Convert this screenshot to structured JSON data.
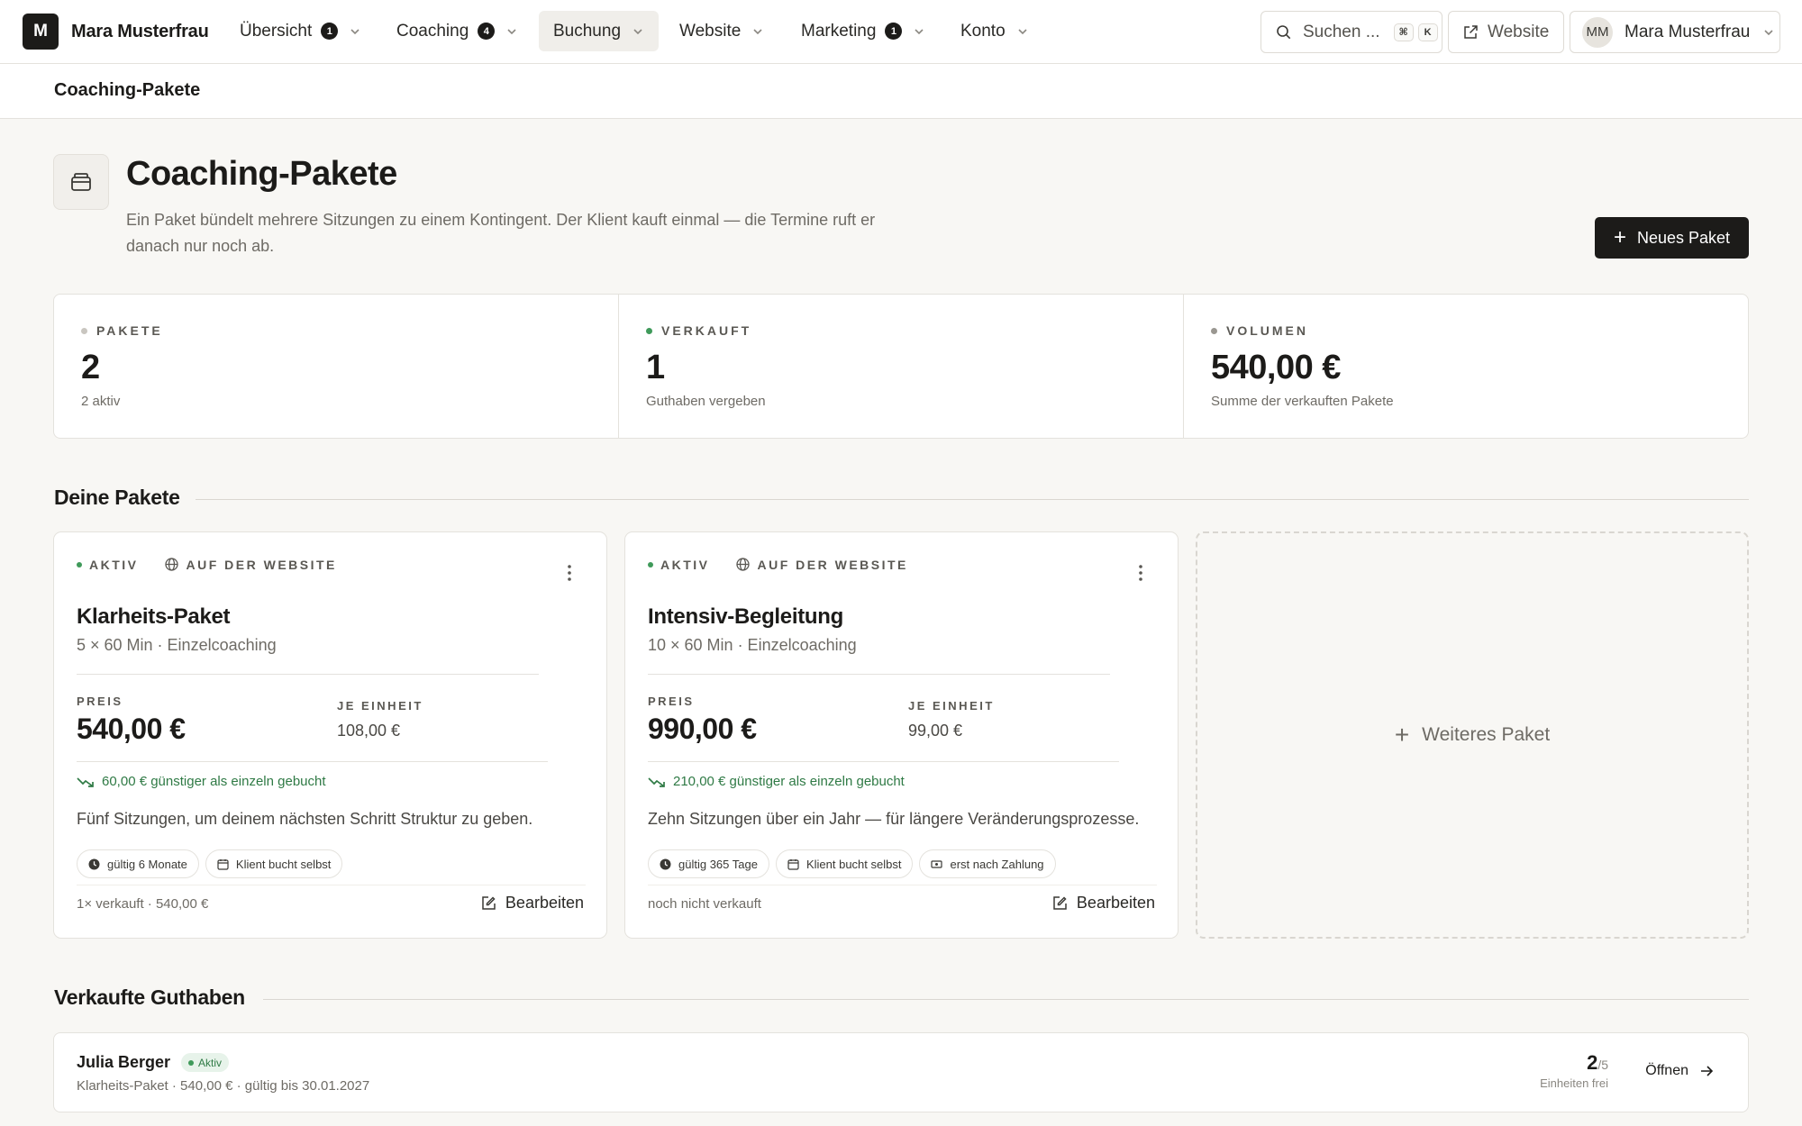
{
  "brand": {
    "initial": "M",
    "name": "Mara Musterfrau"
  },
  "nav": [
    {
      "label": "Übersicht",
      "badge": "1"
    },
    {
      "label": "Coaching",
      "badge": "4"
    },
    {
      "label": "Buchung",
      "badge": ""
    },
    {
      "label": "Website",
      "badge": ""
    },
    {
      "label": "Marketing",
      "badge": "1"
    },
    {
      "label": "Konto",
      "badge": ""
    }
  ],
  "search": {
    "label": "Suchen ...",
    "key1": "⌘",
    "key2": "K"
  },
  "website_button": "Website",
  "user": {
    "initials": "MM",
    "name": "Mara Musterfrau"
  },
  "breadcrumb": "Coaching-Pakete",
  "header": {
    "title": "Coaching-Pakete",
    "description": "Ein Paket bündelt mehrere Sitzungen zu einem Kontingent. Der Klient kauft einmal — die Termine ruft er danach nur noch ab.",
    "new_button": "Neues Paket"
  },
  "stats": [
    {
      "label": "PAKETE",
      "value": "2",
      "sub": "2 aktiv",
      "dot": "#c9c6c0"
    },
    {
      "label": "VERKAUFT",
      "value": "1",
      "sub": "Guthaben vergeben",
      "dot": "#3f9a5a"
    },
    {
      "label": "VOLUMEN",
      "value": "540,00 €",
      "sub": "Summe der verkauften Pakete",
      "dot": "#9a9791"
    }
  ],
  "sections": {
    "packages": "Deine Pakete",
    "credits": "Verkaufte Guthaben"
  },
  "packages": [
    {
      "status": "AKTIV",
      "visibility": "AUF DER WEBSITE",
      "title": "Klarheits-Paket",
      "subtitle": "5 × 60 Min · Einzelcoaching",
      "price_label": "PREIS",
      "price": "540,00 €",
      "unit_label": "JE EINHEIT",
      "unit_price": "108,00 €",
      "saving": "60,00 € günstiger als einzeln gebucht",
      "description": "Fünf Sitzungen, um deinem nächsten Schritt Struktur zu geben.",
      "chips": [
        {
          "icon": "clock-icon",
          "label": "gültig 6 Monate"
        },
        {
          "icon": "calendar-icon",
          "label": "Klient bucht selbst"
        }
      ],
      "footer": "1× verkauft · 540,00 €",
      "edit": "Bearbeiten"
    },
    {
      "status": "AKTIV",
      "visibility": "AUF DER WEBSITE",
      "title": "Intensiv-Begleitung",
      "subtitle": "10 × 60 Min · Einzelcoaching",
      "price_label": "PREIS",
      "price": "990,00 €",
      "unit_label": "JE EINHEIT",
      "unit_price": "99,00 €",
      "saving": "210,00 € günstiger als einzeln gebucht",
      "description": "Zehn Sitzungen über ein Jahr — für längere Veränderungsprozesse.",
      "chips": [
        {
          "icon": "clock-icon",
          "label": "gültig 365 Tage"
        },
        {
          "icon": "calendar-icon",
          "label": "Klient bucht selbst"
        },
        {
          "icon": "payment-icon",
          "label": "erst nach Zahlung"
        }
      ],
      "footer": "noch nicht verkauft",
      "edit": "Bearbeiten"
    }
  ],
  "add_package": "Weiteres Paket",
  "credits": [
    {
      "name": "Julia Berger",
      "status": "Aktiv",
      "meta": "Klarheits-Paket · 540,00 € · gültig bis 30.01.2027",
      "remaining": "2",
      "total": "/5",
      "remaining_label": "Einheiten frei",
      "action": "Öffnen"
    }
  ],
  "colors": {
    "accent": "#1c1b19",
    "success": "#2f7a45",
    "background": "#f8f7f4"
  }
}
